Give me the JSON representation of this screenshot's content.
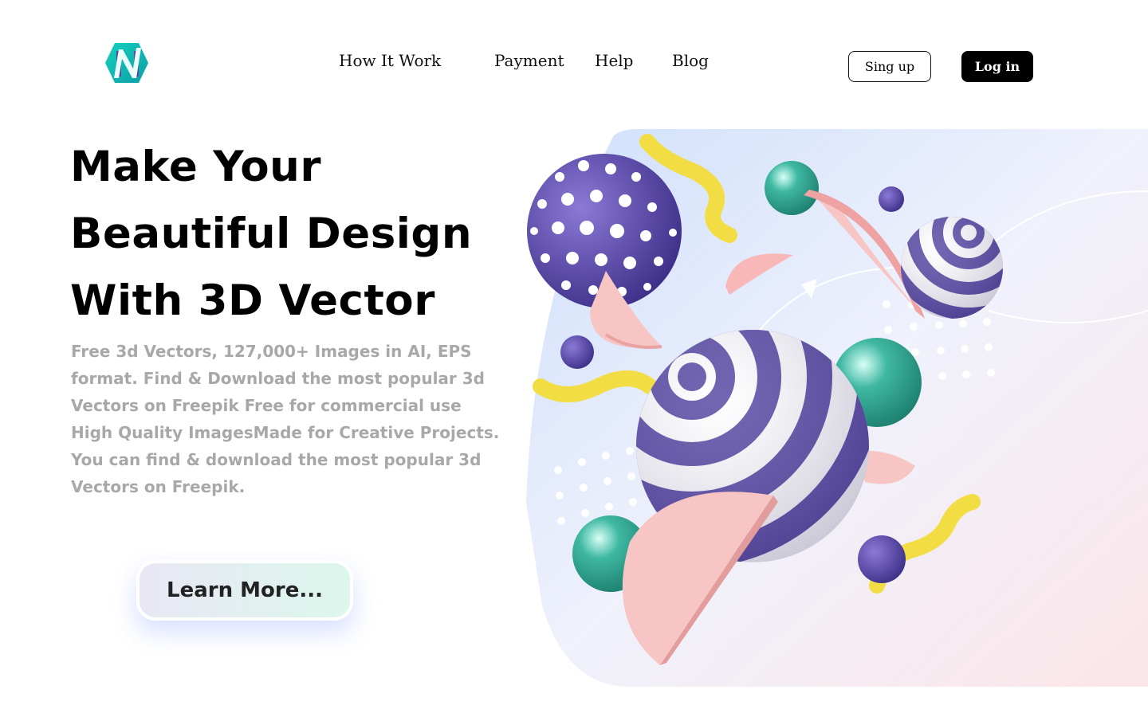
{
  "logo": {
    "icon": "n-letter-logo-icon",
    "colors": [
      "#12c6b6",
      "#5a46a8"
    ]
  },
  "nav": {
    "items": [
      {
        "label": "How It Work"
      },
      {
        "label": "Payment"
      },
      {
        "label": "Help"
      },
      {
        "label": "Blog"
      }
    ]
  },
  "auth": {
    "signup_label": "Sing up",
    "login_label": "Log in"
  },
  "hero": {
    "title_lines": [
      "Make Your",
      "Beautiful Design",
      "With 3D Vector"
    ],
    "description": "Free 3d Vectors, 127,000+ Images in AI, EPS format. Find & Download the most popular 3d Vectors on Freepik Free for commercial use High Quality ImagesMade for Creative Projects. You can find & download the most popular 3d Vectors on Freepik.",
    "cta_label": "Learn More...",
    "illustration": "3d-abstract-shapes-illustration"
  },
  "colors": {
    "accent_purple": "#5a4ba5",
    "accent_teal": "#2fa892",
    "accent_pink": "#f7c6c4",
    "accent_yellow": "#f5e04a",
    "desc_gray": "#a8a8a8"
  }
}
